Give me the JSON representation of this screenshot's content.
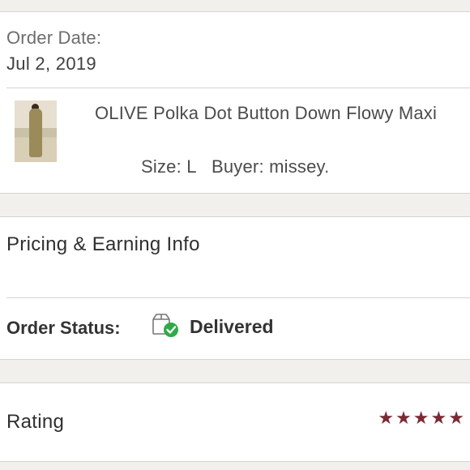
{
  "order": {
    "date_label": "Order Date:",
    "date_value": "Jul 2, 2019"
  },
  "item": {
    "title": "OLIVE Polka Dot Button Down Flowy Maxi",
    "size": "Size: L",
    "buyer": "Buyer: missey."
  },
  "pricing": {
    "heading": "Pricing & Earning Info"
  },
  "status": {
    "label": "Order Status:",
    "value": "Delivered",
    "icon": "delivered-box-check-icon",
    "icon_check_color": "#2eaa4a"
  },
  "rating": {
    "heading": "Rating",
    "stars": 5,
    "max": 5,
    "star_color": "#7a2a33"
  }
}
